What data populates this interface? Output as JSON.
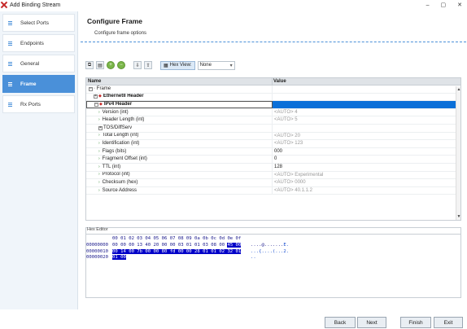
{
  "window": {
    "title": "Add Binding Stream",
    "minimize": "–",
    "maximize": "▢",
    "close": "✕"
  },
  "sidebar": {
    "items": [
      {
        "label": "Select Ports",
        "active": false
      },
      {
        "label": "Endpoints",
        "active": false
      },
      {
        "label": "General",
        "active": false
      },
      {
        "label": "Frame",
        "active": true
      },
      {
        "label": "Rx Ports",
        "active": false
      }
    ]
  },
  "main": {
    "title": "Configure Frame",
    "subtitle": "Configure frame options"
  },
  "toolbar": {
    "hex_view_label": "Hex View:",
    "hex_view_value": "None"
  },
  "grid": {
    "columns": [
      "Name",
      "Value"
    ],
    "rows": [
      {
        "name": "Frame",
        "value": "",
        "level": 0,
        "expander": "−",
        "bold": false,
        "selected": false,
        "dark": false
      },
      {
        "name": "EthernetII Header",
        "value": "",
        "level": 1,
        "expander": "+",
        "bold": true,
        "selected": false,
        "dark": false
      },
      {
        "name": "IPv4 Header",
        "value": "",
        "level": 1,
        "expander": "−",
        "bold": true,
        "selected": true,
        "dark": false
      },
      {
        "name": "Version (int)",
        "value": "<AUTO> 4",
        "level": 2,
        "expander": "",
        "bold": false,
        "selected": false,
        "dark": false
      },
      {
        "name": "Header Length (int)",
        "value": "<AUTO> 5",
        "level": 2,
        "expander": "",
        "bold": false,
        "selected": false,
        "dark": false
      },
      {
        "name": "TOS/DiffServ",
        "value": "",
        "level": 2,
        "expander": "+",
        "bold": false,
        "selected": false,
        "dark": false
      },
      {
        "name": "Total Length (int)",
        "value": "<AUTO> 20",
        "level": 2,
        "expander": "",
        "bold": false,
        "selected": false,
        "dark": false
      },
      {
        "name": "Identification (int)",
        "value": "<AUTO> 123",
        "level": 2,
        "expander": "",
        "bold": false,
        "selected": false,
        "dark": false
      },
      {
        "name": "Flags (bits)",
        "value": "000",
        "level": 2,
        "expander": "",
        "bold": false,
        "selected": false,
        "dark": true
      },
      {
        "name": "Fragment Offset (int)",
        "value": "0",
        "level": 2,
        "expander": "",
        "bold": false,
        "selected": false,
        "dark": true
      },
      {
        "name": "TTL (int)",
        "value": "128",
        "level": 2,
        "expander": "",
        "bold": false,
        "selected": false,
        "dark": true
      },
      {
        "name": "Protocol (int)",
        "value": "<AUTO> Experimental",
        "level": 2,
        "expander": "",
        "bold": false,
        "selected": false,
        "dark": false
      },
      {
        "name": "Checksum (hex)",
        "value": "<AUTO> 0000",
        "level": 2,
        "expander": "",
        "bold": false,
        "selected": false,
        "dark": false
      },
      {
        "name": "Source Address",
        "value": "<AUTO> 40.1.1.2",
        "level": 2,
        "expander": "",
        "bold": false,
        "selected": false,
        "dark": false
      }
    ]
  },
  "hex_editor": {
    "title": "Hex Editor",
    "header": "00 01 02 03 04 05 06 07 08 09 0a 0b 0c 0d 0e 0f",
    "lines": [
      {
        "offset": "00000000",
        "plain": "00 00 00 13 40 20 00 00 03 01 01 03 08 00 ",
        "highlight": "45 00",
        "ascii_plain": "....@.......",
        "ascii_hl": "E."
      },
      {
        "offset": "00000010",
        "plain": "",
        "highlight": "00 14 00 7b 00 00 80 fd 00 00 28 01 01 02 32 01",
        "ascii_plain": "",
        "ascii_hl": "...{....(...2."
      },
      {
        "offset": "00000020",
        "plain": "",
        "highlight": "01 00",
        "ascii_plain": "",
        "ascii_hl": ".."
      }
    ]
  },
  "footer": {
    "back": "Back",
    "next": "Next",
    "finish": "Finish",
    "exit": "Exit"
  },
  "colors": {
    "accent": "#4a90d9",
    "selection": "#0a6fd8",
    "hex_highlight": "#0000c8"
  }
}
